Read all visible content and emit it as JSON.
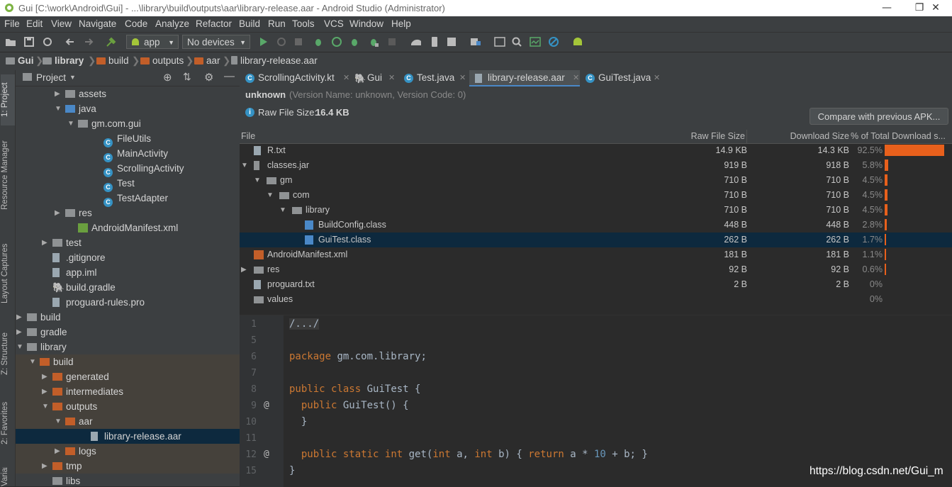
{
  "window": {
    "title": "Gui [C:\\work\\Android\\Gui] - ...\\library\\build\\outputs\\aar\\library-release.aar - Android Studio (Administrator)"
  },
  "menu": [
    "File",
    "Edit",
    "View",
    "Navigate",
    "Code",
    "Analyze",
    "Refactor",
    "Build",
    "Run",
    "Tools",
    "VCS",
    "Window",
    "Help"
  ],
  "toolbar": {
    "run_config": "app",
    "device": "No devices"
  },
  "breadcrumb": [
    "Gui",
    "library",
    "build",
    "outputs",
    "aar",
    "library-release.aar"
  ],
  "side_tabs": [
    "1: Project",
    "Resource Manager",
    "Layout Captures",
    "Z: Structure",
    "2: Favorites",
    "Variants"
  ],
  "project_panel": {
    "title": "Project",
    "tree": [
      {
        "label": "assets",
        "indent": 4,
        "kind": "folder-gray",
        "expander": "closed"
      },
      {
        "label": "java",
        "indent": 4,
        "kind": "folder-blue",
        "expander": "open"
      },
      {
        "label": "gm.com.gui",
        "indent": 5,
        "kind": "package",
        "expander": "open"
      },
      {
        "label": "FileUtils",
        "indent": 7,
        "kind": "class"
      },
      {
        "label": "MainActivity",
        "indent": 7,
        "kind": "class"
      },
      {
        "label": "ScrollingActivity",
        "indent": 7,
        "kind": "class-kt"
      },
      {
        "label": "Test",
        "indent": 7,
        "kind": "class"
      },
      {
        "label": "TestAdapter",
        "indent": 7,
        "kind": "class"
      },
      {
        "label": "res",
        "indent": 4,
        "kind": "folder-gray",
        "expander": "closed"
      },
      {
        "label": "AndroidManifest.xml",
        "indent": 5,
        "kind": "manifest"
      },
      {
        "label": "test",
        "indent": 3,
        "kind": "folder-gray",
        "expander": "closed"
      },
      {
        "label": ".gitignore",
        "indent": 3,
        "kind": "file"
      },
      {
        "label": "app.iml",
        "indent": 3,
        "kind": "file"
      },
      {
        "label": "build.gradle",
        "indent": 3,
        "kind": "gradle"
      },
      {
        "label": "proguard-rules.pro",
        "indent": 3,
        "kind": "file"
      },
      {
        "label": "build",
        "indent": 1,
        "kind": "folder-gray",
        "expander": "closed"
      },
      {
        "label": "gradle",
        "indent": 1,
        "kind": "folder-gray",
        "expander": "closed"
      },
      {
        "label": "library",
        "indent": 1,
        "kind": "folder-module",
        "expander": "open"
      },
      {
        "label": "build",
        "indent": 2,
        "kind": "folder-orange",
        "expander": "open",
        "excluded": true
      },
      {
        "label": "generated",
        "indent": 3,
        "kind": "folder-orange",
        "expander": "closed",
        "excluded": true
      },
      {
        "label": "intermediates",
        "indent": 3,
        "kind": "folder-orange",
        "expander": "closed",
        "excluded": true
      },
      {
        "label": "outputs",
        "indent": 3,
        "kind": "folder-orange",
        "expander": "open",
        "excluded": true
      },
      {
        "label": "aar",
        "indent": 4,
        "kind": "folder-orange",
        "expander": "open",
        "excluded": true
      },
      {
        "label": "library-release.aar",
        "indent": 6,
        "kind": "aar",
        "selected": true
      },
      {
        "label": "logs",
        "indent": 4,
        "kind": "folder-orange",
        "expander": "closed",
        "excluded": true
      },
      {
        "label": "tmp",
        "indent": 3,
        "kind": "folder-orange",
        "expander": "closed",
        "excluded": true
      },
      {
        "label": "libs",
        "indent": 3,
        "kind": "folder-gray"
      }
    ]
  },
  "editor_tabs": [
    {
      "label": "ScrollingActivity.kt",
      "icon": "kotlin-class-icon"
    },
    {
      "label": "Gui",
      "icon": "gradle-icon"
    },
    {
      "label": "Test.java",
      "icon": "class-icon"
    },
    {
      "label": "library-release.aar",
      "icon": "aar-icon",
      "active": true
    },
    {
      "label": "GuiTest.java",
      "icon": "class-icon"
    }
  ],
  "apk_info": {
    "app_id": "unknown",
    "version": "(Version Name: unknown, Version Code: 0)",
    "raw_size_label": "Raw File Size:",
    "raw_size": "16.4 KB",
    "compare_button": "Compare with previous APK..."
  },
  "file_table": {
    "headers": {
      "file": "File",
      "raw": "Raw File Size",
      "download": "Download Size",
      "percent": "% of Total Download s..."
    },
    "rows": [
      {
        "name": "R.txt",
        "indent": 1,
        "raw": "14.9 KB",
        "download": "14.3 KB",
        "percent": "92.5%",
        "share": 92.5,
        "expander": "",
        "icon": "file"
      },
      {
        "name": "classes.jar",
        "indent": 1,
        "raw": "919 B",
        "download": "918 B",
        "percent": "5.8%",
        "share": 5.8,
        "expander": "open",
        "icon": "jar"
      },
      {
        "name": "gm",
        "indent": 2,
        "raw": "710 B",
        "download": "710 B",
        "percent": "4.5%",
        "share": 4.5,
        "expander": "open",
        "icon": "folder"
      },
      {
        "name": "com",
        "indent": 3,
        "raw": "710 B",
        "download": "710 B",
        "percent": "4.5%",
        "share": 4.5,
        "expander": "open",
        "icon": "folder"
      },
      {
        "name": "library",
        "indent": 4,
        "raw": "710 B",
        "download": "710 B",
        "percent": "4.5%",
        "share": 4.5,
        "expander": "open",
        "icon": "folder"
      },
      {
        "name": "BuildConfig.class",
        "indent": 5,
        "raw": "448 B",
        "download": "448 B",
        "percent": "2.8%",
        "share": 2.8,
        "expander": "",
        "icon": "class"
      },
      {
        "name": "GuiTest.class",
        "indent": 5,
        "raw": "262 B",
        "download": "262 B",
        "percent": "1.7%",
        "share": 1.7,
        "expander": "",
        "icon": "class",
        "selected": true
      },
      {
        "name": "AndroidManifest.xml",
        "indent": 1,
        "raw": "181 B",
        "download": "181 B",
        "percent": "1.1%",
        "share": 1.1,
        "expander": "",
        "icon": "manifest"
      },
      {
        "name": "res",
        "indent": 1,
        "raw": "92 B",
        "download": "92 B",
        "percent": "0.6%",
        "share": 0.6,
        "expander": "closed",
        "icon": "folder"
      },
      {
        "name": "proguard.txt",
        "indent": 1,
        "raw": "2 B",
        "download": "2 B",
        "percent": "0%",
        "share": 0,
        "expander": "",
        "icon": "file"
      },
      {
        "name": "values",
        "indent": 1,
        "raw": "",
        "download": "",
        "percent": "0%",
        "share": 0,
        "expander": "",
        "icon": "folder"
      }
    ]
  },
  "code": {
    "lines": [
      {
        "n": "1",
        "text": "/.../",
        "type": "fold"
      },
      {
        "n": "5",
        "text": ""
      },
      {
        "n": "6",
        "text": "package gm.com.library;",
        "type": "package"
      },
      {
        "n": "7",
        "text": ""
      },
      {
        "n": "8",
        "text": "public class GuiTest {",
        "type": "class"
      },
      {
        "n": "9",
        "text": "  public GuiTest() {",
        "type": "ctor",
        "mark": "@"
      },
      {
        "n": "10",
        "text": "  }"
      },
      {
        "n": "11",
        "text": ""
      },
      {
        "n": "12",
        "text": "  public static int get(int a, int b) { return a * 10 + b; }",
        "type": "method",
        "mark": "@"
      },
      {
        "n": "15",
        "text": "}"
      }
    ]
  },
  "watermark": "https://blog.csdn.net/Gui_m",
  "colors": {
    "bar": "#e8601c",
    "selection": "#0d293e",
    "accent": "#4a88c7"
  }
}
